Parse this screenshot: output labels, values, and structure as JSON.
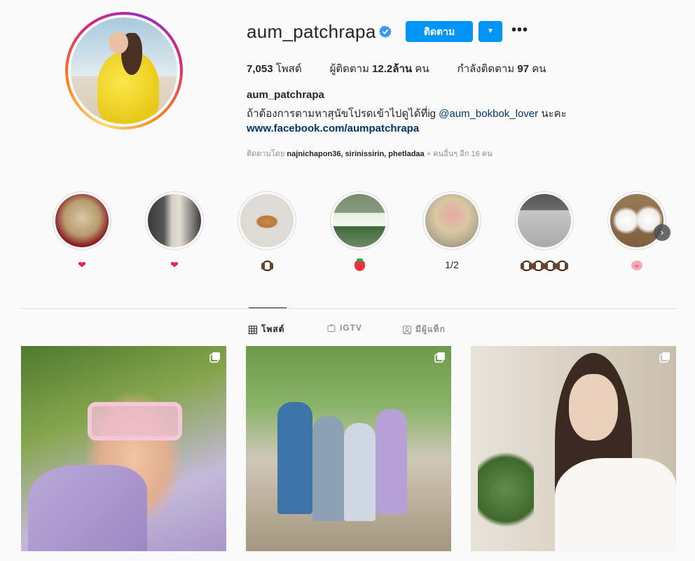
{
  "profile": {
    "username": "aum_patchrapa",
    "follow_label": "ติดตาม",
    "dropdown_glyph": "▼",
    "more_glyph": "•••",
    "stats": {
      "posts_value": "7,053",
      "posts_label": " โพสต์",
      "followers_label": "ผู้ติดตาม ",
      "followers_value": "12.2ล้าน",
      "followers_suffix": " คน",
      "following_label": "กำลังติดตาม ",
      "following_value": "97",
      "following_suffix": " คน"
    },
    "full_name": "aum_patchrapa",
    "bio_text": "ถ้าต้องการตามหาสุนัขโปรดเข้าไปดูได้ที่ig ",
    "bio_mention": "@aum_bokbok_lover",
    "bio_suffix": " นะคะ",
    "website": "www.facebook.com/aumpatchrapa",
    "followed_by": {
      "prefix": "ติดตามโดย ",
      "names": "najnichapon36, sirinissirin, phetladaa",
      "suffix": " + คนอื่นๆ อีก 16 คน"
    }
  },
  "highlights": [
    {
      "label": "❤",
      "icon": "heart"
    },
    {
      "label": "❤",
      "icon": "heart"
    },
    {
      "label": "",
      "icon": "dog-face"
    },
    {
      "label": "",
      "icon": "strawberry"
    },
    {
      "label": "1/2",
      "icon": ""
    },
    {
      "label": "",
      "icon": "dog-face x4"
    },
    {
      "label": "",
      "icon": "pig-face"
    }
  ],
  "tabs": [
    {
      "label": "โพสต์",
      "icon": "grid-icon",
      "active": true
    },
    {
      "label": "IGTV",
      "icon": "igtv-icon",
      "active": false
    },
    {
      "label": "มีผู้แท็ก",
      "icon": "tagged-icon",
      "active": false
    }
  ],
  "colors": {
    "accent": "#0095f6",
    "link": "#00376b",
    "muted": "#8e8e8e",
    "background": "#fafafa"
  }
}
